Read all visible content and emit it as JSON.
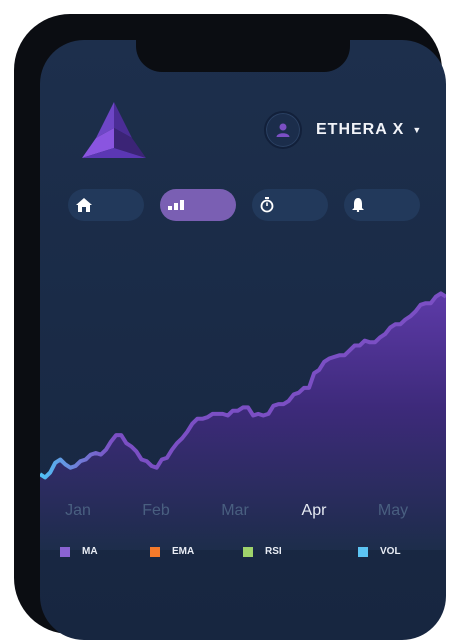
{
  "header": {
    "user_name": "ETHERA X",
    "dropdown_icon": "caret-down-icon"
  },
  "nav": [
    {
      "icon": "home-icon",
      "active": false
    },
    {
      "icon": "chart-bars-icon",
      "active": true
    },
    {
      "icon": "stopwatch-icon",
      "active": false
    },
    {
      "icon": "bell-icon",
      "active": false
    }
  ],
  "colors": {
    "accent": "#7a5fb3",
    "line": "#7b4fc4",
    "line_start": "#4fc3f7"
  },
  "chart_data": {
    "type": "area",
    "categories": [
      "Jan",
      "Feb",
      "Mar",
      "Apr",
      "May"
    ],
    "highlighted": "Apr",
    "x": [
      0,
      0.5,
      1,
      1.5,
      2,
      2.5,
      3,
      3.5,
      4,
      4.5,
      5,
      5.5,
      6,
      6.5,
      7,
      7.5,
      8,
      8.5,
      9,
      9.5,
      10,
      10.5,
      11,
      11.5,
      12,
      12.5,
      13,
      13.5,
      14,
      14.5,
      15,
      15.5,
      16,
      16.5,
      17,
      17.5,
      18,
      18.5,
      19,
      19.5,
      20,
      20.5,
      21,
      21.5,
      22,
      22.5,
      23,
      23.5,
      24,
      24.5,
      25,
      25.5,
      26,
      26.5,
      27,
      27.5,
      28,
      28.5,
      29,
      29.5,
      30,
      30.5,
      31,
      31.5,
      32,
      32.5,
      33,
      33.5,
      34,
      34.5,
      35,
      35.5,
      36,
      36.5,
      37,
      37.5,
      38,
      38.5,
      39,
      39.5,
      40
    ],
    "values": [
      22,
      20,
      23,
      29,
      31,
      28,
      26,
      27,
      30,
      31,
      34,
      35,
      34,
      37,
      42,
      46,
      46,
      41,
      39,
      36,
      31,
      30,
      27,
      26,
      31,
      32,
      37,
      41,
      44,
      48,
      53,
      56,
      56,
      57,
      59,
      59,
      59,
      58,
      61,
      61,
      63,
      63,
      58,
      59,
      58,
      59,
      64,
      65,
      65,
      67,
      71,
      72,
      75,
      75,
      84,
      86,
      91,
      93,
      94,
      95,
      95,
      98,
      101,
      101,
      104,
      103,
      103,
      106,
      108,
      112,
      114,
      114,
      117,
      119,
      122,
      126,
      127,
      127,
      131,
      133,
      131
    ],
    "series_legend": [
      {
        "name": "MA",
        "color": "#8a63d2"
      },
      {
        "name": "EMA",
        "color": "#f47a2b"
      },
      {
        "name": "RSI",
        "color": "#9fd36b"
      },
      {
        "name": "VOL",
        "color": "#5cc4f3"
      }
    ],
    "grid": false
  }
}
